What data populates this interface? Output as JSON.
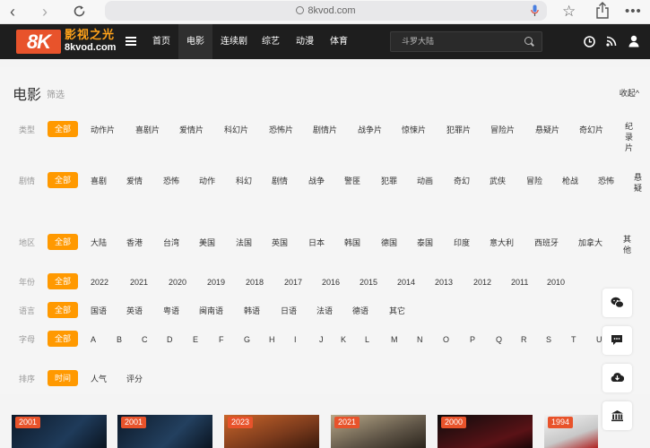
{
  "browser": {
    "url": "8kvod.com"
  },
  "site": {
    "logo_mark": "8K",
    "logo_name": "影视之光",
    "logo_url": "8kvod.com",
    "nav": [
      "首页",
      "电影",
      "连续剧",
      "综艺",
      "动漫",
      "体育"
    ],
    "nav_active": "电影",
    "search_placeholder": "斗罗大陆"
  },
  "panel": {
    "title": "电影",
    "subtitle": "筛选",
    "collapse": "收起^",
    "rows": [
      {
        "label": "类型",
        "items": [
          "全部",
          "动作片",
          "喜剧片",
          "爱情片",
          "科幻片",
          "恐怖片",
          "剧情片",
          "战争片",
          "惊悚片",
          "犯罪片",
          "冒险片",
          "悬疑片",
          "奇幻片",
          "纪录片"
        ]
      },
      {
        "label": "剧情",
        "items": [
          "全部",
          "喜剧",
          "爱情",
          "恐怖",
          "动作",
          "科幻",
          "剧情",
          "战争",
          "警匪",
          "犯罪",
          "动画",
          "奇幻",
          "武侠",
          "冒险",
          "枪战",
          "恐怖",
          "悬疑"
        ]
      },
      {
        "label": "地区",
        "items": [
          "全部",
          "大陆",
          "香港",
          "台湾",
          "美国",
          "法国",
          "英国",
          "日本",
          "韩国",
          "德国",
          "泰国",
          "印度",
          "意大利",
          "西班牙",
          "加拿大",
          "其他"
        ]
      },
      {
        "label": "年份",
        "items": [
          "全部",
          "2022",
          "2021",
          "2020",
          "2019",
          "2018",
          "2017",
          "2016",
          "2015",
          "2014",
          "2013",
          "2012",
          "2011",
          "2010"
        ]
      },
      {
        "label": "语言",
        "items": [
          "全部",
          "国语",
          "英语",
          "粤语",
          "闽南语",
          "韩语",
          "日语",
          "法语",
          "德语",
          "其它"
        ]
      },
      {
        "label": "字母",
        "items": [
          "全部",
          "A",
          "B",
          "C",
          "D",
          "E",
          "F",
          "G",
          "H",
          "I",
          "J",
          "K",
          "L",
          "M",
          "N",
          "O",
          "P",
          "Q",
          "R",
          "S",
          "T",
          "U"
        ]
      },
      {
        "label": "排序",
        "items": [
          "时间",
          "人气",
          "评分"
        ]
      }
    ]
  },
  "side_buttons": [
    "wechat-icon",
    "chat-icon",
    "cloud-download-icon",
    "bank-icon"
  ],
  "posters": [
    {
      "year": "2001"
    },
    {
      "year": "2001"
    },
    {
      "year": "2023"
    },
    {
      "year": "2021"
    },
    {
      "year": "2000"
    },
    {
      "year": "1994"
    }
  ],
  "colors": {
    "accent": "#ff9900",
    "logo": "#e8532b",
    "header_bg": "#1e1e1e"
  }
}
